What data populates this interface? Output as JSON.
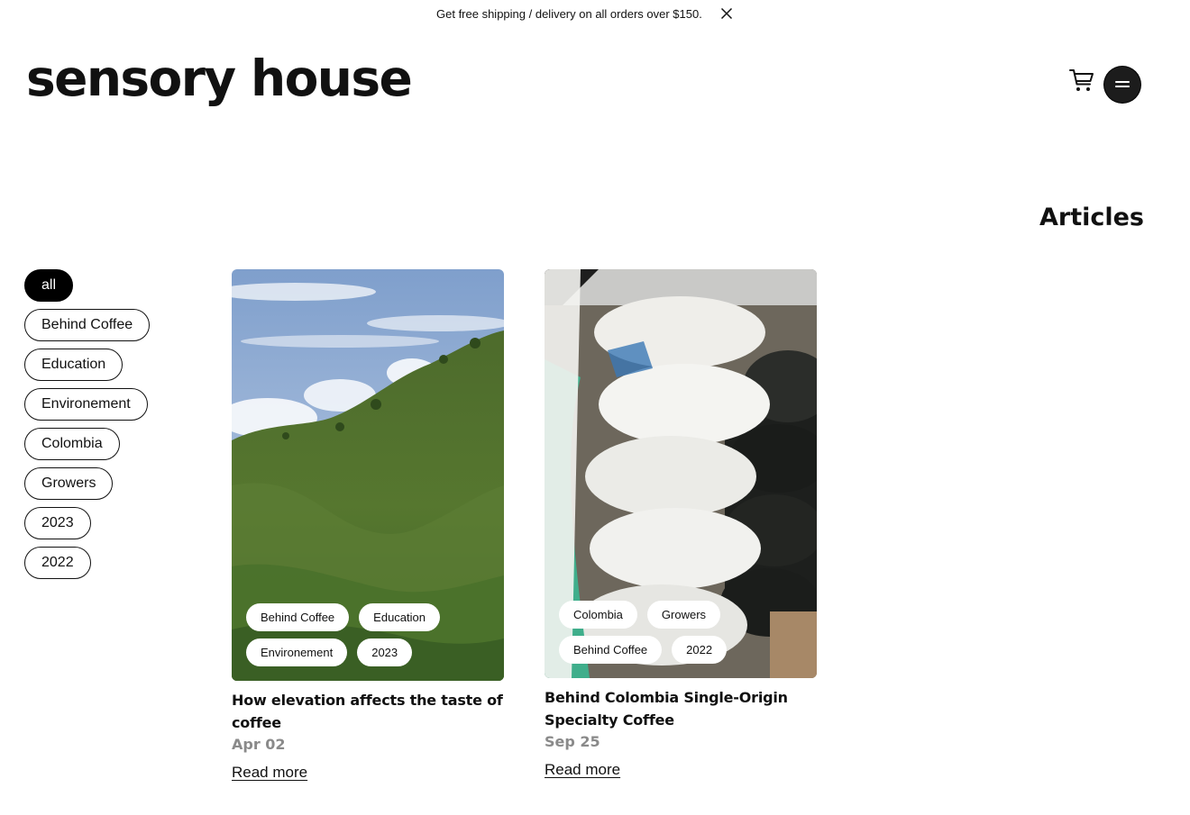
{
  "announcement": {
    "text": "Get free shipping / delivery on all orders over $150."
  },
  "header": {
    "logo": "sensory house"
  },
  "main": {
    "title": "Articles"
  },
  "filters": [
    {
      "label": "all",
      "active": true
    },
    {
      "label": "Behind Coffee",
      "active": false
    },
    {
      "label": "Education",
      "active": false
    },
    {
      "label": "Environement",
      "active": false
    },
    {
      "label": "Colombia",
      "active": false
    },
    {
      "label": "Growers",
      "active": false
    },
    {
      "label": "2023",
      "active": false
    },
    {
      "label": "2022",
      "active": false
    }
  ],
  "articles": [
    {
      "tags": [
        "Behind Coffee",
        "Education",
        "Environement",
        "2023"
      ],
      "title": "How elevation affects the taste of coffee",
      "date": "Apr 02",
      "link": "Read more",
      "image": "green coffee-growing hillside under a blue cloudy sky"
    },
    {
      "tags": [
        "Colombia",
        "Growers",
        "Behind Coffee",
        "2022"
      ],
      "title": "Behind Colombia Single-Origin Specialty Coffee",
      "date": "Sep 25",
      "link": "Read more",
      "image": "stacked white, green and black coffee sacks"
    }
  ],
  "colors": {
    "text": "#111111",
    "date": "#8a8a8a",
    "active_filter_bg": "#000000",
    "menu_button_bg": "#1c1c1c"
  },
  "icons": [
    "close-icon",
    "cart-icon",
    "menu-icon"
  ]
}
